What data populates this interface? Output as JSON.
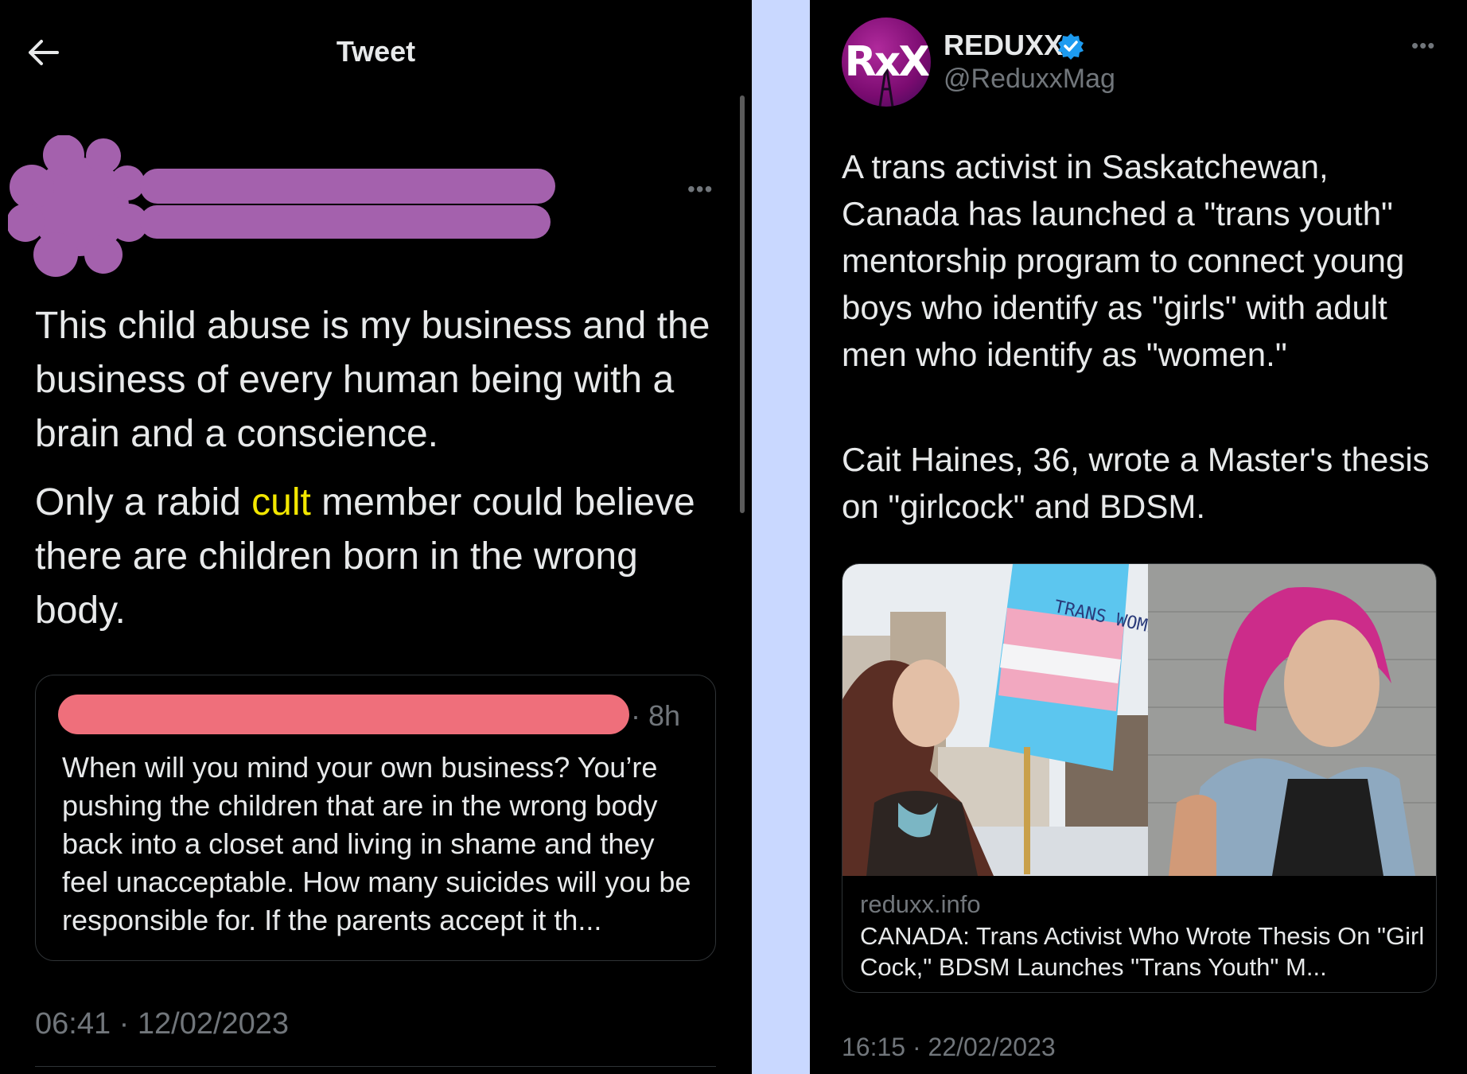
{
  "left_tweet": {
    "header_title": "Tweet",
    "text_p1": "This child abuse is my business and the business of every human being with a brain and a conscience.",
    "text_p2_before": "Only a rabid ",
    "text_p2_highlight": "cult",
    "text_p2_after": " member could believe there are children born in the wrong body.",
    "highlight_color": "#f2e600",
    "quoted": {
      "time": "· 8h",
      "text": "When will you mind your own business?  You’re pushing the children that are in the wrong body back into a closet and living in shame and they feel unacceptable. How many suicides will you be responsible for. If the parents accept it th..."
    },
    "timestamp": "06:41 · 12/02/2023",
    "redaction_colors": {
      "author": "#a461ad",
      "quoted_author": "#ef6f7b"
    }
  },
  "right_tweet": {
    "avatar_text": "RxX",
    "display_name": "REDUXX",
    "verified": true,
    "handle": "@ReduxxMag",
    "text_p1": "A trans activist in Saskatchewan, Canada has launched a \"trans youth\" mentorship program to connect young boys who identify as \"girls\" with adult men who identify as \"women.\"",
    "text_p2": "Cait Haines, 36, wrote a Master's thesis on \"girlcock\" and BDSM.",
    "sign_text": "TRANS WOMEN ARE WOMEN",
    "card": {
      "domain": "reduxx.info",
      "title": "CANADA: Trans Activist Who Wrote Thesis On \"Girl Cock,\" BDSM Launches \"Trans Youth\" M..."
    },
    "timestamp": "16:15 · 22/02/2023"
  },
  "colors": {
    "background": "#000000",
    "gutter": "#c9d8ff",
    "muted": "#71767b",
    "verified": "#1d9bf0"
  }
}
